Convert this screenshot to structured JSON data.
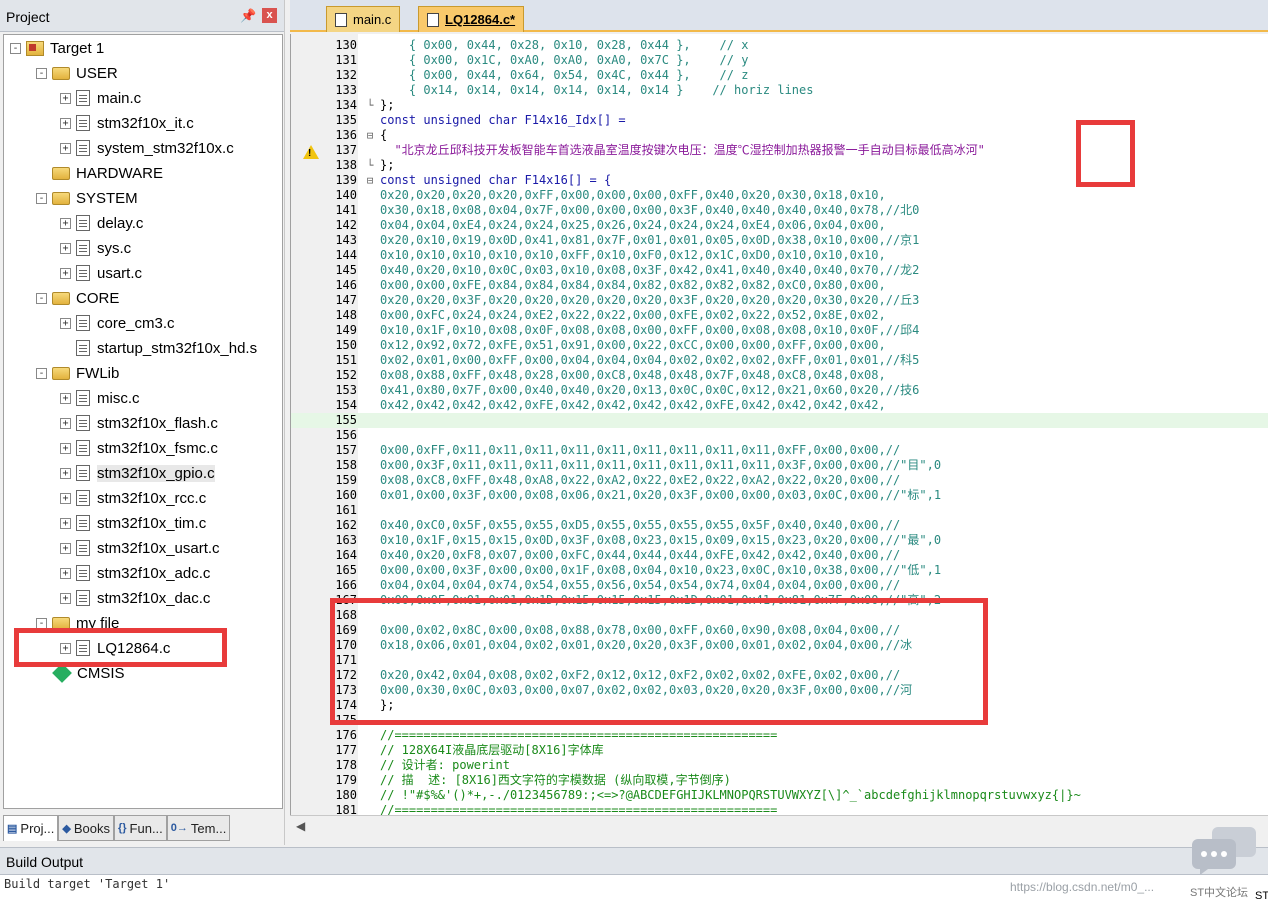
{
  "project_panel": {
    "title": "Project",
    "pin_icon": "pin-icon",
    "close_label": "x",
    "tree": [
      {
        "label": "Target 1",
        "type": "target",
        "level": 0,
        "exp": "-"
      },
      {
        "label": "USER",
        "type": "folder",
        "level": 1,
        "exp": "-"
      },
      {
        "label": "main.c",
        "type": "file",
        "level": 2,
        "exp": "+"
      },
      {
        "label": "stm32f10x_it.c",
        "type": "file",
        "level": 2,
        "exp": "+"
      },
      {
        "label": "system_stm32f10x.c",
        "type": "file",
        "level": 2,
        "exp": "+"
      },
      {
        "label": "HARDWARE",
        "type": "folder",
        "level": 1,
        "exp": ""
      },
      {
        "label": "SYSTEM",
        "type": "folder",
        "level": 1,
        "exp": "-"
      },
      {
        "label": "delay.c",
        "type": "file",
        "level": 2,
        "exp": "+"
      },
      {
        "label": "sys.c",
        "type": "file",
        "level": 2,
        "exp": "+"
      },
      {
        "label": "usart.c",
        "type": "file",
        "level": 2,
        "exp": "+"
      },
      {
        "label": "CORE",
        "type": "folder",
        "level": 1,
        "exp": "-"
      },
      {
        "label": "core_cm3.c",
        "type": "file",
        "level": 2,
        "exp": "+"
      },
      {
        "label": "startup_stm32f10x_hd.s",
        "type": "file",
        "level": 2,
        "exp": ""
      },
      {
        "label": "FWLib",
        "type": "folder",
        "level": 1,
        "exp": "-"
      },
      {
        "label": "misc.c",
        "type": "file",
        "level": 2,
        "exp": "+"
      },
      {
        "label": "stm32f10x_flash.c",
        "type": "file",
        "level": 2,
        "exp": "+"
      },
      {
        "label": "stm32f10x_fsmc.c",
        "type": "file",
        "level": 2,
        "exp": "+"
      },
      {
        "label": "stm32f10x_gpio.c",
        "type": "file",
        "level": 2,
        "exp": "+"
      },
      {
        "label": "stm32f10x_rcc.c",
        "type": "file",
        "level": 2,
        "exp": "+"
      },
      {
        "label": "stm32f10x_tim.c",
        "type": "file",
        "level": 2,
        "exp": "+"
      },
      {
        "label": "stm32f10x_usart.c",
        "type": "file",
        "level": 2,
        "exp": "+"
      },
      {
        "label": "stm32f10x_adc.c",
        "type": "file",
        "level": 2,
        "exp": "+"
      },
      {
        "label": "stm32f10x_dac.c",
        "type": "file",
        "level": 2,
        "exp": "+"
      },
      {
        "label": "my file",
        "type": "folder",
        "level": 1,
        "exp": "-"
      },
      {
        "label": "LQ12864.c",
        "type": "file",
        "level": 2,
        "exp": "+"
      },
      {
        "label": "CMSIS",
        "type": "gem",
        "level": 1,
        "exp": ""
      }
    ],
    "bottom_tabs": [
      {
        "label": "Proj...",
        "icon": "project-icon"
      },
      {
        "label": "Books",
        "icon": "books-icon"
      },
      {
        "label": "Fun...",
        "icon": "functions-icon"
      },
      {
        "label": "Tem...",
        "icon": "templates-icon"
      }
    ]
  },
  "editor_tabs": [
    {
      "label": "main.c",
      "active": false
    },
    {
      "label": "LQ12864.c*",
      "active": true
    }
  ],
  "code_lines": [
    {
      "n": "130",
      "f": "",
      "t": "    { 0x00, 0x44, 0x28, 0x10, 0x28, 0x44 },    // x",
      "c": "teal"
    },
    {
      "n": "131",
      "f": "",
      "t": "    { 0x00, 0x1C, 0xA0, 0xA0, 0xA0, 0x7C },    // y",
      "c": "teal"
    },
    {
      "n": "132",
      "f": "",
      "t": "    { 0x00, 0x44, 0x64, 0x54, 0x4C, 0x44 },    // z",
      "c": "teal"
    },
    {
      "n": "133",
      "f": "",
      "t": "    { 0x14, 0x14, 0x14, 0x14, 0x14, 0x14 }    // horiz lines",
      "c": "teal"
    },
    {
      "n": "134",
      "f": "└",
      "t": "};",
      "c": ""
    },
    {
      "n": "135",
      "f": "",
      "t": "const unsigned char F14x16_Idx[] =",
      "c": "blue"
    },
    {
      "n": "136",
      "f": "⊟",
      "t": "{",
      "c": ""
    },
    {
      "n": "137",
      "f": "",
      "t": "  \"北京龙丘邱科技开发板智能车首选液晶室温度按键次电压：温度℃湿控制加热器报警一手自动目标最低高冰河\"",
      "c": "purple"
    },
    {
      "n": "138",
      "f": "└",
      "t": "};",
      "c": ""
    },
    {
      "n": "139",
      "f": "⊟",
      "t": "const unsigned char F14x16[] = {",
      "c": "blue"
    },
    {
      "n": "140",
      "f": "",
      "t": "0x20,0x20,0x20,0x20,0xFF,0x00,0x00,0x00,0xFF,0x40,0x20,0x30,0x18,0x10,",
      "c": "teal"
    },
    {
      "n": "141",
      "f": "",
      "t": "0x30,0x18,0x08,0x04,0x7F,0x00,0x00,0x00,0x3F,0x40,0x40,0x40,0x40,0x78,//北0",
      "c": "teal"
    },
    {
      "n": "142",
      "f": "",
      "t": "0x04,0x04,0xE4,0x24,0x24,0x25,0x26,0x24,0x24,0x24,0xE4,0x06,0x04,0x00,",
      "c": "teal"
    },
    {
      "n": "143",
      "f": "",
      "t": "0x20,0x10,0x19,0x0D,0x41,0x81,0x7F,0x01,0x01,0x05,0x0D,0x38,0x10,0x00,//京1",
      "c": "teal"
    },
    {
      "n": "144",
      "f": "",
      "t": "0x10,0x10,0x10,0x10,0x10,0xFF,0x10,0xF0,0x12,0x1C,0xD0,0x10,0x10,0x10,",
      "c": "teal"
    },
    {
      "n": "145",
      "f": "",
      "t": "0x40,0x20,0x10,0x0C,0x03,0x10,0x08,0x3F,0x42,0x41,0x40,0x40,0x40,0x70,//龙2",
      "c": "teal"
    },
    {
      "n": "146",
      "f": "",
      "t": "0x00,0x00,0xFE,0x84,0x84,0x84,0x84,0x82,0x82,0x82,0x82,0xC0,0x80,0x00,",
      "c": "teal"
    },
    {
      "n": "147",
      "f": "",
      "t": "0x20,0x20,0x3F,0x20,0x20,0x20,0x20,0x20,0x3F,0x20,0x20,0x20,0x30,0x20,//丘3",
      "c": "teal"
    },
    {
      "n": "148",
      "f": "",
      "t": "0x00,0xFC,0x24,0x24,0xE2,0x22,0x22,0x00,0xFE,0x02,0x22,0x52,0x8E,0x02,",
      "c": "teal"
    },
    {
      "n": "149",
      "f": "",
      "t": "0x10,0x1F,0x10,0x08,0x0F,0x08,0x08,0x00,0xFF,0x00,0x08,0x08,0x10,0x0F,//邱4",
      "c": "teal"
    },
    {
      "n": "150",
      "f": "",
      "t": "0x12,0x92,0x72,0xFE,0x51,0x91,0x00,0x22,0xCC,0x00,0x00,0xFF,0x00,0x00,",
      "c": "teal"
    },
    {
      "n": "151",
      "f": "",
      "t": "0x02,0x01,0x00,0xFF,0x00,0x04,0x04,0x04,0x02,0x02,0x02,0xFF,0x01,0x01,//科5",
      "c": "teal"
    },
    {
      "n": "152",
      "f": "",
      "t": "0x08,0x88,0xFF,0x48,0x28,0x00,0xC8,0x48,0x48,0x7F,0x48,0xC8,0x48,0x08,",
      "c": "teal"
    },
    {
      "n": "153",
      "f": "",
      "t": "0x41,0x80,0x7F,0x00,0x40,0x40,0x20,0x13,0x0C,0x0C,0x12,0x21,0x60,0x20,//技6",
      "c": "teal"
    },
    {
      "n": "154",
      "f": "",
      "t": "0x42,0x42,0x42,0x42,0xFE,0x42,0x42,0x42,0x42,0xFE,0x42,0x42,0x42,0x42,",
      "c": "teal"
    },
    {
      "n": "155",
      "f": "",
      "t": "",
      "c": "hl"
    },
    {
      "n": "156",
      "f": "",
      "t": "",
      "c": ""
    },
    {
      "n": "157",
      "f": "",
      "t": "0x00,0xFF,0x11,0x11,0x11,0x11,0x11,0x11,0x11,0x11,0x11,0xFF,0x00,0x00,//",
      "c": "teal"
    },
    {
      "n": "158",
      "f": "",
      "t": "0x00,0x3F,0x11,0x11,0x11,0x11,0x11,0x11,0x11,0x11,0x11,0x3F,0x00,0x00,//\"目\",0",
      "c": "teal"
    },
    {
      "n": "159",
      "f": "",
      "t": "0x08,0xC8,0xFF,0x48,0xA8,0x22,0xA2,0x22,0xE2,0x22,0xA2,0x22,0x20,0x00,//",
      "c": "teal"
    },
    {
      "n": "160",
      "f": "",
      "t": "0x01,0x00,0x3F,0x00,0x08,0x06,0x21,0x20,0x3F,0x00,0x00,0x03,0x0C,0x00,//\"标\",1",
      "c": "teal"
    },
    {
      "n": "161",
      "f": "",
      "t": "",
      "c": ""
    },
    {
      "n": "162",
      "f": "",
      "t": "0x40,0xC0,0x5F,0x55,0x55,0xD5,0x55,0x55,0x55,0x55,0x5F,0x40,0x40,0x00,//",
      "c": "teal"
    },
    {
      "n": "163",
      "f": "",
      "t": "0x10,0x1F,0x15,0x15,0x0D,0x3F,0x08,0x23,0x15,0x09,0x15,0x23,0x20,0x00,//\"最\",0",
      "c": "teal"
    },
    {
      "n": "164",
      "f": "",
      "t": "0x40,0x20,0xF8,0x07,0x00,0xFC,0x44,0x44,0x44,0xFE,0x42,0x42,0x40,0x00,//",
      "c": "teal"
    },
    {
      "n": "165",
      "f": "",
      "t": "0x00,0x00,0x3F,0x00,0x00,0x1F,0x08,0x04,0x10,0x23,0x0C,0x10,0x38,0x00,//\"低\",1",
      "c": "teal"
    },
    {
      "n": "166",
      "f": "",
      "t": "0x04,0x04,0x04,0x74,0x54,0x55,0x56,0x54,0x54,0x74,0x04,0x04,0x00,0x00,//",
      "c": "teal"
    },
    {
      "n": "167",
      "f": "",
      "t": "0x00,0x0F,0x01,0x01,0x1D,0x15,0x15,0x15,0x1D,0x01,0x41,0x81,0x7F,0x00,//\"高\",2",
      "c": "teal"
    },
    {
      "n": "168",
      "f": "",
      "t": "",
      "c": ""
    },
    {
      "n": "169",
      "f": "",
      "t": "0x00,0x02,0x8C,0x00,0x08,0x88,0x78,0x00,0xFF,0x60,0x90,0x08,0x04,0x00,//",
      "c": "teal"
    },
    {
      "n": "170",
      "f": "",
      "t": "0x18,0x06,0x01,0x04,0x02,0x01,0x20,0x20,0x3F,0x00,0x01,0x02,0x04,0x00,//冰",
      "c": "teal"
    },
    {
      "n": "171",
      "f": "",
      "t": "",
      "c": ""
    },
    {
      "n": "172",
      "f": "",
      "t": "0x20,0x42,0x04,0x08,0x02,0xF2,0x12,0x12,0xF2,0x02,0x02,0xFE,0x02,0x00,//",
      "c": "teal"
    },
    {
      "n": "173",
      "f": "",
      "t": "0x00,0x30,0x0C,0x03,0x00,0x07,0x02,0x02,0x03,0x20,0x20,0x3F,0x00,0x00,//河",
      "c": "teal"
    },
    {
      "n": "174",
      "f": "",
      "t": "};",
      "c": ""
    },
    {
      "n": "175",
      "f": "",
      "t": "",
      "c": ""
    },
    {
      "n": "176",
      "f": "",
      "t": "//=====================================================",
      "c": "green"
    },
    {
      "n": "177",
      "f": "",
      "t": "// 128X64I液晶底层驱动[8X16]字体库",
      "c": "green"
    },
    {
      "n": "178",
      "f": "",
      "t": "// 设计者: powerint",
      "c": "green"
    },
    {
      "n": "179",
      "f": "",
      "t": "// 描  述: [8X16]西文字符的字模数据 (纵向取模,字节倒序)",
      "c": "green"
    },
    {
      "n": "180",
      "f": "",
      "t": "// !\"#$%&'()*+,-./0123456789:;<=>?@ABCDEFGHIJKLMNOPQRSTUVWXYZ[\\]^_`abcdefghijklmnopqrstuvwxyz{|}~",
      "c": "green"
    },
    {
      "n": "181",
      "f": "",
      "t": "//=====================================================",
      "c": "green"
    }
  ],
  "build_output": {
    "title": "Build Output",
    "line": "Build target 'Target 1'"
  },
  "watermark": "https://blog.csdn.net/m0_...",
  "st_label": "ST",
  "st_forum": "ST中文论坛",
  "highlight_color": "#e83b3b"
}
